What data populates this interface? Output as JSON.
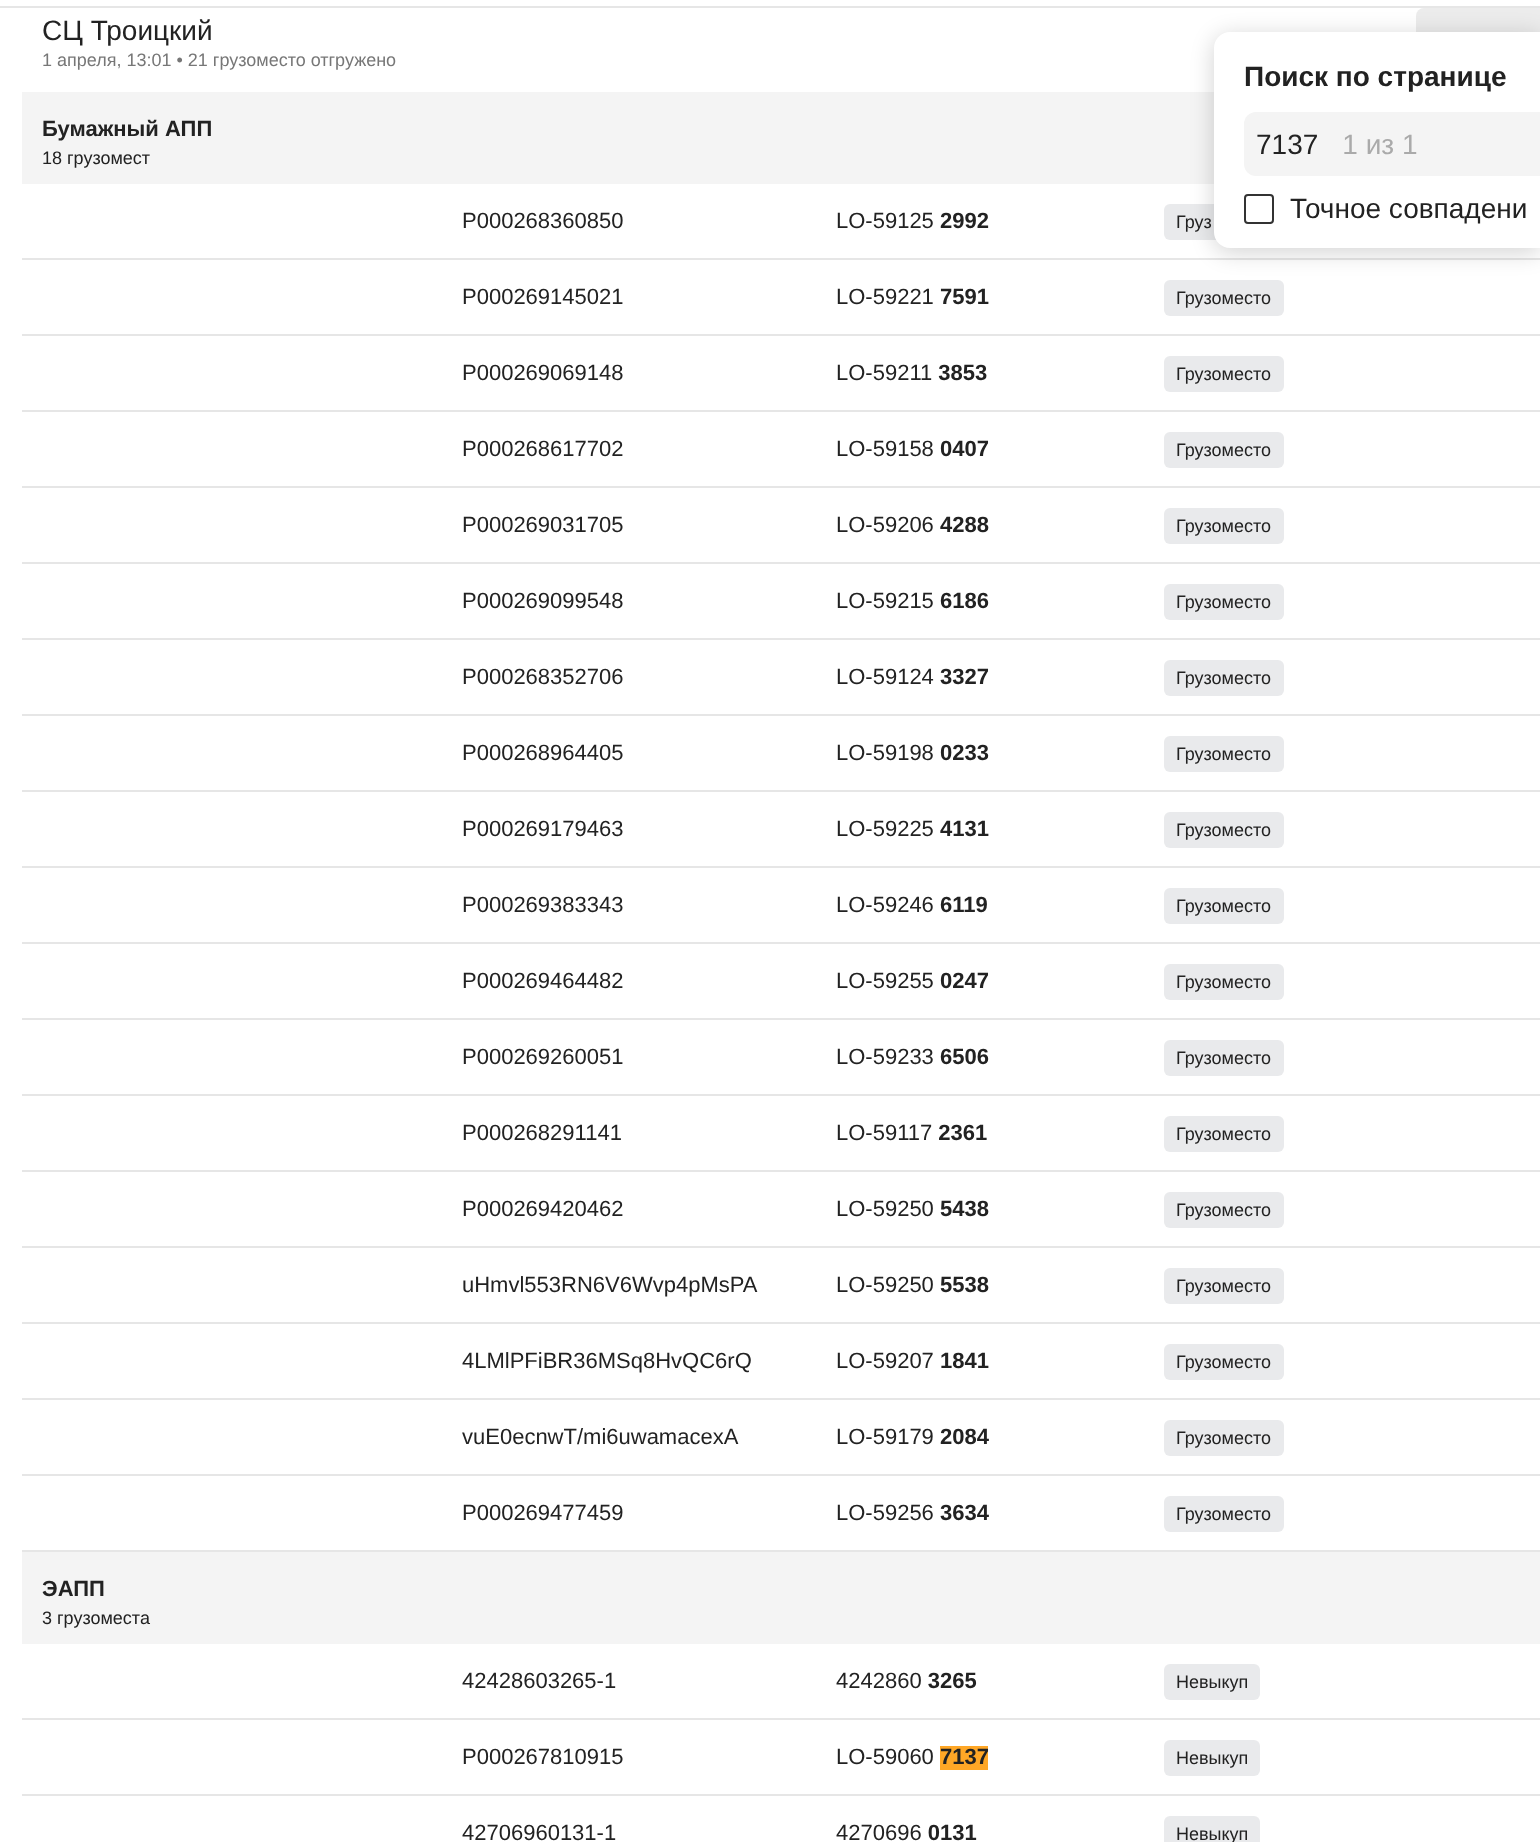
{
  "header": {
    "title": "СЦ Троицкий",
    "subtitle": "1 апреля, 13:01 • 21 грузоместо отгружено"
  },
  "groups": [
    {
      "title": "Бумажный АПП",
      "count": "18 грузомест",
      "rows": [
        {
          "code": "P000268360850",
          "ref_prefix": "LO-59125",
          "ref_suffix": "2992",
          "match": false,
          "tag": "Груз"
        },
        {
          "code": "P000269145021",
          "ref_prefix": "LO-59221",
          "ref_suffix": "7591",
          "match": false,
          "tag": "Грузоместо"
        },
        {
          "code": "P000269069148",
          "ref_prefix": "LO-59211",
          "ref_suffix": "3853",
          "match": false,
          "tag": "Грузоместо"
        },
        {
          "code": "P000268617702",
          "ref_prefix": "LO-59158",
          "ref_suffix": "0407",
          "match": false,
          "tag": "Грузоместо"
        },
        {
          "code": "P000269031705",
          "ref_prefix": "LO-59206",
          "ref_suffix": "4288",
          "match": false,
          "tag": "Грузоместо"
        },
        {
          "code": "P000269099548",
          "ref_prefix": "LO-59215",
          "ref_suffix": "6186",
          "match": false,
          "tag": "Грузоместо"
        },
        {
          "code": "P000268352706",
          "ref_prefix": "LO-59124",
          "ref_suffix": "3327",
          "match": false,
          "tag": "Грузоместо"
        },
        {
          "code": "P000268964405",
          "ref_prefix": "LO-59198",
          "ref_suffix": "0233",
          "match": false,
          "tag": "Грузоместо"
        },
        {
          "code": "P000269179463",
          "ref_prefix": "LO-59225",
          "ref_suffix": "4131",
          "match": false,
          "tag": "Грузоместо"
        },
        {
          "code": "P000269383343",
          "ref_prefix": "LO-59246",
          "ref_suffix": "6119",
          "match": false,
          "tag": "Грузоместо"
        },
        {
          "code": "P000269464482",
          "ref_prefix": "LO-59255",
          "ref_suffix": "0247",
          "match": false,
          "tag": "Грузоместо"
        },
        {
          "code": "P000269260051",
          "ref_prefix": "LO-59233",
          "ref_suffix": "6506",
          "match": false,
          "tag": "Грузоместо"
        },
        {
          "code": "P000268291141",
          "ref_prefix": "LO-59117",
          "ref_suffix": "2361",
          "match": false,
          "tag": "Грузоместо"
        },
        {
          "code": "P000269420462",
          "ref_prefix": "LO-59250",
          "ref_suffix": "5438",
          "match": false,
          "tag": "Грузоместо"
        },
        {
          "code": "uHmvl553RN6V6Wvp4pMsPA",
          "ref_prefix": "LO-59250",
          "ref_suffix": "5538",
          "match": false,
          "tag": "Грузоместо"
        },
        {
          "code": "4LMlPFiBR36MSq8HvQC6rQ",
          "ref_prefix": "LO-59207",
          "ref_suffix": "1841",
          "match": false,
          "tag": "Грузоместо"
        },
        {
          "code": "vuE0ecnwT/mi6uwamacexA",
          "ref_prefix": "LO-59179",
          "ref_suffix": "2084",
          "match": false,
          "tag": "Грузоместо"
        },
        {
          "code": "P000269477459",
          "ref_prefix": "LO-59256",
          "ref_suffix": "3634",
          "match": false,
          "tag": "Грузоместо"
        }
      ]
    },
    {
      "title": "ЭАПП",
      "count": "3 грузоместа",
      "rows": [
        {
          "code": "42428603265-1",
          "ref_prefix": "4242860",
          "ref_suffix": "3265",
          "match": false,
          "tag": "Невыкуп"
        },
        {
          "code": "P000267810915",
          "ref_prefix": "LO-59060",
          "ref_suffix": "7137",
          "match": true,
          "tag": "Невыкуп"
        },
        {
          "code": "42706960131-1",
          "ref_prefix": "4270696",
          "ref_suffix": "0131",
          "match": false,
          "tag": "Невыкуп"
        }
      ]
    }
  ],
  "find": {
    "title": "Поиск по странице",
    "value": "7137",
    "result": "1 из 1",
    "exact_label": "Точное совпадени",
    "exact_checked": false
  }
}
